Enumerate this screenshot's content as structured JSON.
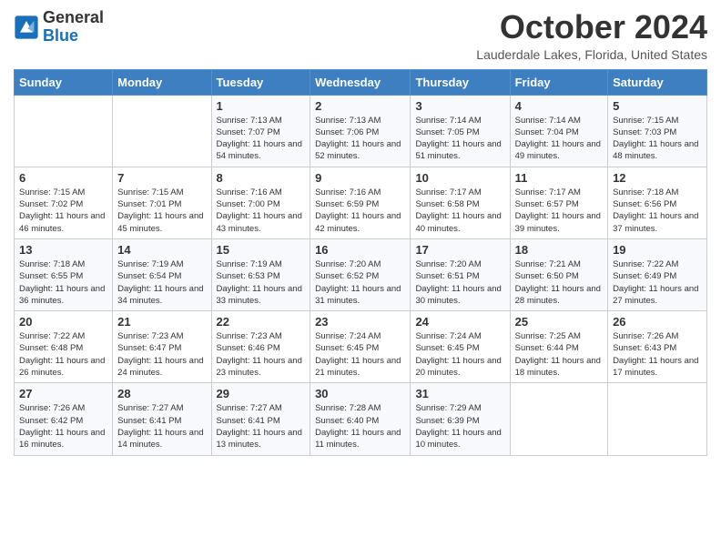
{
  "header": {
    "logo_general": "General",
    "logo_blue": "Blue",
    "month_title": "October 2024",
    "location": "Lauderdale Lakes, Florida, United States"
  },
  "days_of_week": [
    "Sunday",
    "Monday",
    "Tuesday",
    "Wednesday",
    "Thursday",
    "Friday",
    "Saturday"
  ],
  "weeks": [
    [
      null,
      null,
      {
        "day": 1,
        "sunrise": "7:13 AM",
        "sunset": "7:07 PM",
        "daylight": "11 hours and 54 minutes."
      },
      {
        "day": 2,
        "sunrise": "7:13 AM",
        "sunset": "7:06 PM",
        "daylight": "11 hours and 52 minutes."
      },
      {
        "day": 3,
        "sunrise": "7:14 AM",
        "sunset": "7:05 PM",
        "daylight": "11 hours and 51 minutes."
      },
      {
        "day": 4,
        "sunrise": "7:14 AM",
        "sunset": "7:04 PM",
        "daylight": "11 hours and 49 minutes."
      },
      {
        "day": 5,
        "sunrise": "7:15 AM",
        "sunset": "7:03 PM",
        "daylight": "11 hours and 48 minutes."
      }
    ],
    [
      {
        "day": 6,
        "sunrise": "7:15 AM",
        "sunset": "7:02 PM",
        "daylight": "11 hours and 46 minutes."
      },
      {
        "day": 7,
        "sunrise": "7:15 AM",
        "sunset": "7:01 PM",
        "daylight": "11 hours and 45 minutes."
      },
      {
        "day": 8,
        "sunrise": "7:16 AM",
        "sunset": "7:00 PM",
        "daylight": "11 hours and 43 minutes."
      },
      {
        "day": 9,
        "sunrise": "7:16 AM",
        "sunset": "6:59 PM",
        "daylight": "11 hours and 42 minutes."
      },
      {
        "day": 10,
        "sunrise": "7:17 AM",
        "sunset": "6:58 PM",
        "daylight": "11 hours and 40 minutes."
      },
      {
        "day": 11,
        "sunrise": "7:17 AM",
        "sunset": "6:57 PM",
        "daylight": "11 hours and 39 minutes."
      },
      {
        "day": 12,
        "sunrise": "7:18 AM",
        "sunset": "6:56 PM",
        "daylight": "11 hours and 37 minutes."
      }
    ],
    [
      {
        "day": 13,
        "sunrise": "7:18 AM",
        "sunset": "6:55 PM",
        "daylight": "11 hours and 36 minutes."
      },
      {
        "day": 14,
        "sunrise": "7:19 AM",
        "sunset": "6:54 PM",
        "daylight": "11 hours and 34 minutes."
      },
      {
        "day": 15,
        "sunrise": "7:19 AM",
        "sunset": "6:53 PM",
        "daylight": "11 hours and 33 minutes."
      },
      {
        "day": 16,
        "sunrise": "7:20 AM",
        "sunset": "6:52 PM",
        "daylight": "11 hours and 31 minutes."
      },
      {
        "day": 17,
        "sunrise": "7:20 AM",
        "sunset": "6:51 PM",
        "daylight": "11 hours and 30 minutes."
      },
      {
        "day": 18,
        "sunrise": "7:21 AM",
        "sunset": "6:50 PM",
        "daylight": "11 hours and 28 minutes."
      },
      {
        "day": 19,
        "sunrise": "7:22 AM",
        "sunset": "6:49 PM",
        "daylight": "11 hours and 27 minutes."
      }
    ],
    [
      {
        "day": 20,
        "sunrise": "7:22 AM",
        "sunset": "6:48 PM",
        "daylight": "11 hours and 26 minutes."
      },
      {
        "day": 21,
        "sunrise": "7:23 AM",
        "sunset": "6:47 PM",
        "daylight": "11 hours and 24 minutes."
      },
      {
        "day": 22,
        "sunrise": "7:23 AM",
        "sunset": "6:46 PM",
        "daylight": "11 hours and 23 minutes."
      },
      {
        "day": 23,
        "sunrise": "7:24 AM",
        "sunset": "6:45 PM",
        "daylight": "11 hours and 21 minutes."
      },
      {
        "day": 24,
        "sunrise": "7:24 AM",
        "sunset": "6:45 PM",
        "daylight": "11 hours and 20 minutes."
      },
      {
        "day": 25,
        "sunrise": "7:25 AM",
        "sunset": "6:44 PM",
        "daylight": "11 hours and 18 minutes."
      },
      {
        "day": 26,
        "sunrise": "7:26 AM",
        "sunset": "6:43 PM",
        "daylight": "11 hours and 17 minutes."
      }
    ],
    [
      {
        "day": 27,
        "sunrise": "7:26 AM",
        "sunset": "6:42 PM",
        "daylight": "11 hours and 16 minutes."
      },
      {
        "day": 28,
        "sunrise": "7:27 AM",
        "sunset": "6:41 PM",
        "daylight": "11 hours and 14 minutes."
      },
      {
        "day": 29,
        "sunrise": "7:27 AM",
        "sunset": "6:41 PM",
        "daylight": "11 hours and 13 minutes."
      },
      {
        "day": 30,
        "sunrise": "7:28 AM",
        "sunset": "6:40 PM",
        "daylight": "11 hours and 11 minutes."
      },
      {
        "day": 31,
        "sunrise": "7:29 AM",
        "sunset": "6:39 PM",
        "daylight": "11 hours and 10 minutes."
      },
      null,
      null
    ]
  ]
}
